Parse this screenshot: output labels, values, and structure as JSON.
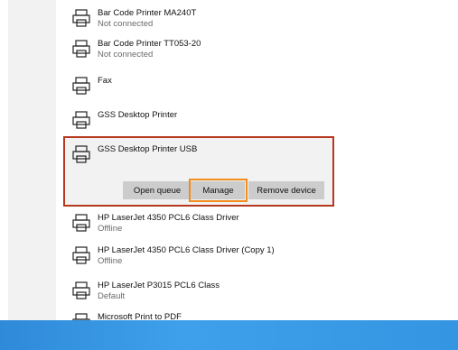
{
  "printers": [
    {
      "name": "Bar Code Printer MA240T",
      "status": "Not connected",
      "icon": "printer-icon"
    },
    {
      "name": "Bar Code Printer TT053-20",
      "status": "Not connected",
      "icon": "printer-icon"
    },
    {
      "name": "Fax",
      "status": "",
      "icon": "printer-icon"
    },
    {
      "name": "GSS Desktop Printer",
      "status": "",
      "icon": "printer-icon"
    },
    {
      "name": "GSS Desktop Printer USB",
      "status": "",
      "icon": "printer-icon"
    },
    {
      "name": "HP LaserJet 4350 PCL6 Class Driver",
      "status": "Offline",
      "icon": "printer-icon"
    },
    {
      "name": "HP LaserJet 4350 PCL6 Class Driver (Copy 1)",
      "status": "Offline",
      "icon": "printer-icon"
    },
    {
      "name": "HP LaserJet P3015 PCL6 Class",
      "status": "Default",
      "icon": "printer-icon"
    },
    {
      "name": "Microsoft Print to PDF",
      "status": "",
      "icon": "printer-icon"
    }
  ],
  "selected_actions": {
    "open_queue": "Open queue",
    "manage": "Manage",
    "remove_device": "Remove device"
  },
  "colors": {
    "selection_border": "#b5381f",
    "manage_highlight": "#f28c1b",
    "taskbar": "#3495e2"
  }
}
